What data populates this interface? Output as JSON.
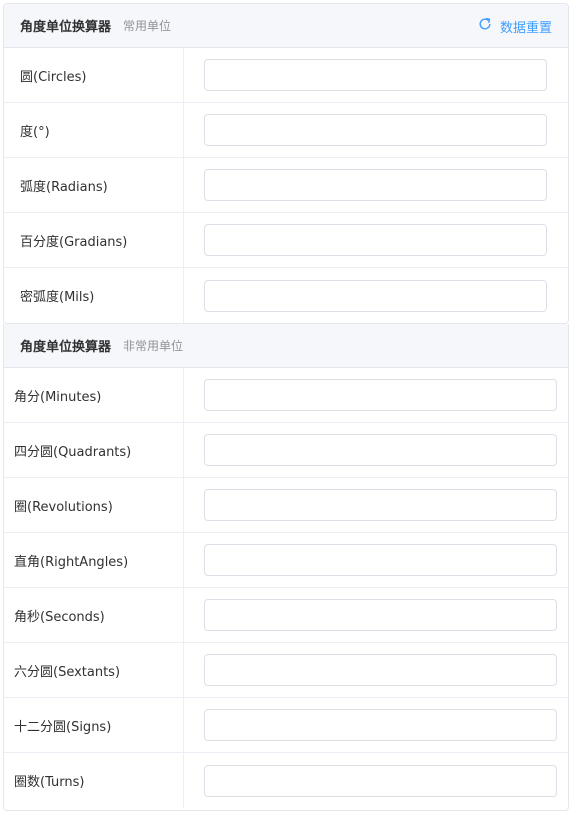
{
  "common": {
    "title": "角度单位换算器",
    "subtitle": "常用单位",
    "reset_label": "数据重置",
    "rows": [
      {
        "label": "圆(Circles)",
        "value": ""
      },
      {
        "label": "度(°)",
        "value": ""
      },
      {
        "label": "弧度(Radians)",
        "value": ""
      },
      {
        "label": "百分度(Gradians)",
        "value": ""
      },
      {
        "label": "密弧度(Mils)",
        "value": ""
      }
    ]
  },
  "uncommon": {
    "title": "角度单位换算器",
    "subtitle": "非常用单位",
    "rows": [
      {
        "label": "角分(Minutes)",
        "value": ""
      },
      {
        "label": "四分圆(Quadrants)",
        "value": ""
      },
      {
        "label": "圈(Revolutions)",
        "value": ""
      },
      {
        "label": "直角(RightAngles)",
        "value": ""
      },
      {
        "label": "角秒(Seconds)",
        "value": ""
      },
      {
        "label": "六分圆(Sextants)",
        "value": ""
      },
      {
        "label": "十二分圆(Signs)",
        "value": ""
      },
      {
        "label": "圈数(Turns)",
        "value": ""
      }
    ]
  },
  "colors": {
    "accent": "#409eff",
    "header_bg": "#f5f7fa",
    "border": "#e4e7ed"
  }
}
